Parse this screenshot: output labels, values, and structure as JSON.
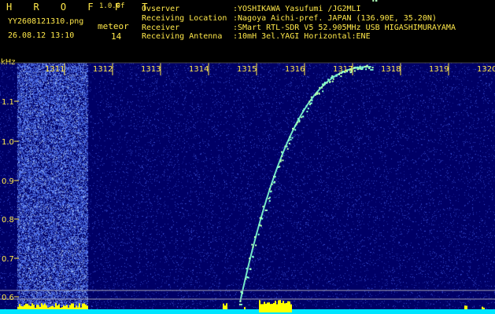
{
  "header": {
    "logo": "H R O F F T",
    "version": "1.0.0f",
    "filename": "YY2608121310.png",
    "datetime": "26.08.12 13:10",
    "meteor_label": "meteor",
    "meteor_count": "14",
    "info": [
      {
        "key": "Ovserver",
        "value": ":YOSHIKAWA Yasufumi /JG2MLI"
      },
      {
        "key": "Receiving Location",
        "value": ":Nagoya Aichi-pref. JAPAN (136.90E, 35.20N)"
      },
      {
        "key": "Receiver",
        "value": ":SMart RTL-SDR V5 52.905MHz USB HIGASHIMURAYAMA"
      },
      {
        "key": "Receiving Antenna",
        "value": ":10mH 3el.YAGI Horizontal:ENE"
      }
    ]
  },
  "spectrogram": {
    "y_unit": "kHz",
    "y_ticks": [
      "1.1",
      "1.0",
      "0.9",
      "0.8",
      "0.7",
      "0.6"
    ],
    "x_ticks": [
      "1311",
      "1312",
      "1313",
      "1314",
      "1315",
      "1316",
      "1317",
      "1318",
      "1319",
      "1320"
    ],
    "colors": {
      "background": "#000066",
      "noise": "#3a5cff",
      "trace": "#7fffd4",
      "label": "#ffe84a",
      "bar": "#ffff00",
      "baseline": "#00e5ff"
    }
  }
}
